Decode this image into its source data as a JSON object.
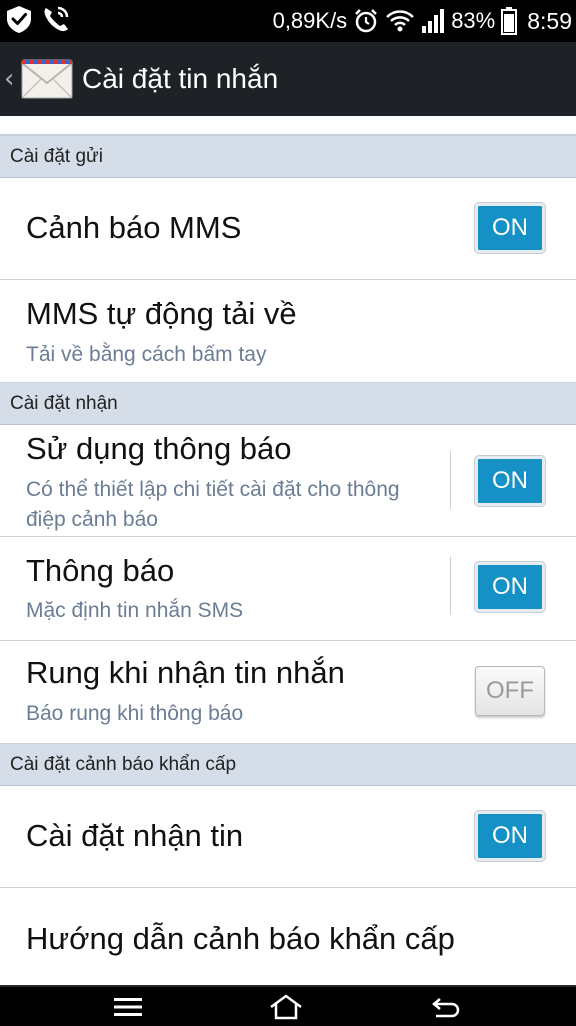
{
  "status_bar": {
    "speed": "0,89K/s",
    "battery": "83%",
    "time": "8:59"
  },
  "header": {
    "title": "Cài đặt tin nhắn"
  },
  "sections": {
    "send": {
      "label": "Cài đặt gửi",
      "mms_alert": {
        "title": "Cảnh báo MMS",
        "toggle": "ON"
      },
      "mms_auto": {
        "title": "MMS tự động tải về",
        "summary": "Tải về bằng cách bấm tay"
      }
    },
    "receive": {
      "label": "Cài đặt nhận",
      "use_notif": {
        "title": "Sử dụng thông báo",
        "summary": "Có thể thiết lập chi tiết cài đặt cho thông điệp cảnh báo",
        "toggle": "ON"
      },
      "notif": {
        "title": "Thông báo",
        "summary": "Mặc định tin nhắn SMS",
        "toggle": "ON"
      },
      "vibrate": {
        "title": "Rung khi nhận tin nhắn",
        "summary": "Báo rung khi thông báo",
        "toggle": "OFF"
      }
    },
    "emergency": {
      "label": "Cài đặt cảnh báo khẩn cấp",
      "receive_setting": {
        "title": "Cài đặt nhận tin",
        "toggle": "ON"
      },
      "guide": {
        "title": "Hướng dẫn cảnh báo khẩn cấp"
      }
    }
  },
  "colors": {
    "toggle_on": "#1591c6",
    "section_bg": "#d5dee8",
    "summary_text": "#6b7d95"
  },
  "icons": {
    "status_left": [
      "check-shield-icon",
      "phone-call-icon"
    ],
    "status_right": [
      "alarm-icon",
      "wifi-icon",
      "signal-icon",
      "battery-icon"
    ],
    "nav": [
      "menu-icon",
      "home-icon",
      "back-icon"
    ]
  }
}
